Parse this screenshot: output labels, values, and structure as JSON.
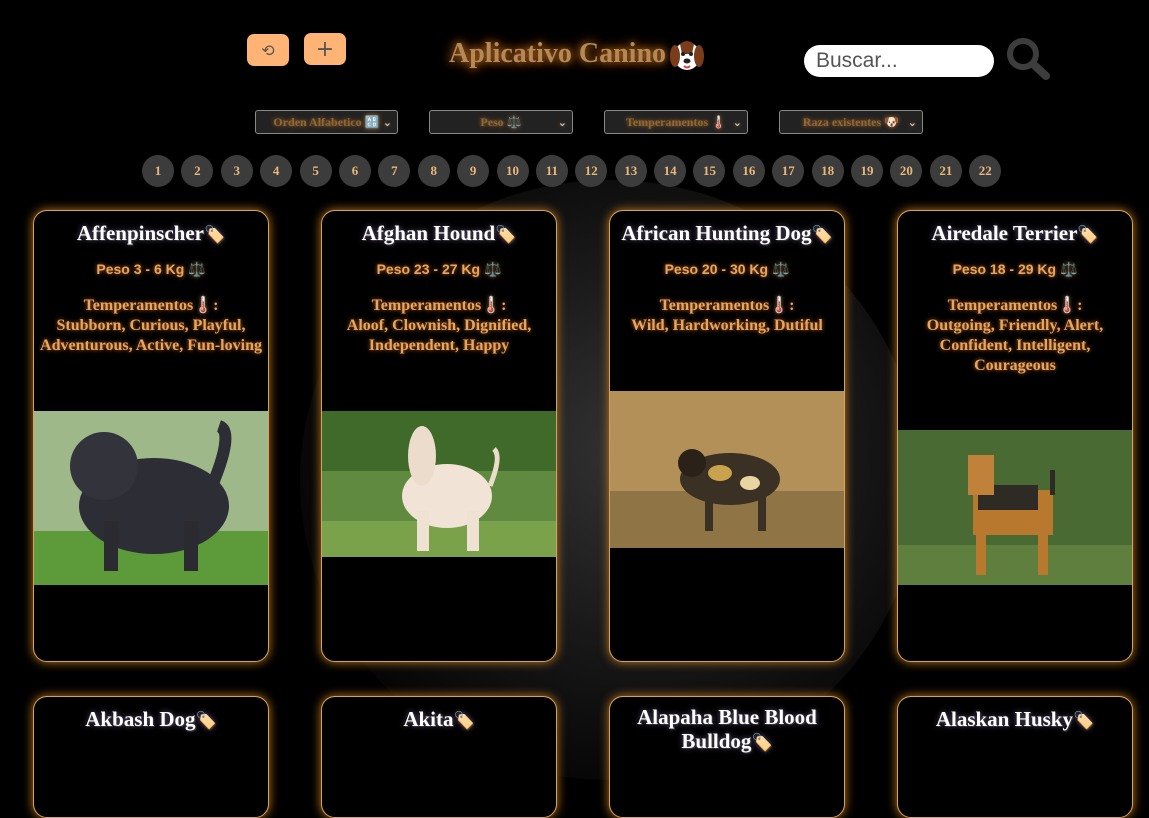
{
  "header": {
    "title": "Aplicativo Canino",
    "refresh_icon": "refresh-icon",
    "add_icon": "plus-icon",
    "search": {
      "placeholder": "Buscar...",
      "value": ""
    },
    "colors": {
      "accent": "#ffb374",
      "title_glow": "#c06a20",
      "card_border": "#d4a264"
    }
  },
  "filters": [
    {
      "label": "Orden Alfabetico 🔠"
    },
    {
      "label": "Peso ⚖️"
    },
    {
      "label": "Temperamentos 🌡️"
    },
    {
      "label": "Raza existentes 🐶"
    }
  ],
  "pagination": [
    "1",
    "2",
    "3",
    "4",
    "5",
    "6",
    "7",
    "8",
    "9",
    "10",
    "11",
    "12",
    "13",
    "14",
    "15",
    "16",
    "17",
    "18",
    "19",
    "20",
    "21",
    "22"
  ],
  "cards": [
    {
      "name": "Affenpinscher",
      "weight": "Peso 3 - 6 Kg",
      "temperament_label": "Temperamentos",
      "temperaments": "Stubborn, Curious, Playful, Adventurous, Active, Fun-loving"
    },
    {
      "name": "Afghan Hound",
      "weight": "Peso 23 - 27 Kg",
      "temperament_label": "Temperamentos",
      "temperaments": "Aloof, Clownish, Dignified, Independent, Happy"
    },
    {
      "name": "African Hunting Dog",
      "weight": "Peso 20 - 30 Kg",
      "temperament_label": "Temperamentos",
      "temperaments": "Wild, Hardworking, Dutiful"
    },
    {
      "name": "Airedale Terrier",
      "weight": "Peso 18 - 29 Kg",
      "temperament_label": "Temperamentos",
      "temperaments": "Outgoing, Friendly, Alert, Confident, Intelligent, Courageous"
    },
    {
      "name": "Akbash Dog"
    },
    {
      "name": "Akita"
    },
    {
      "name": "Alapaha Blue Blood Bulldog"
    },
    {
      "name": "Alaskan Husky"
    }
  ]
}
